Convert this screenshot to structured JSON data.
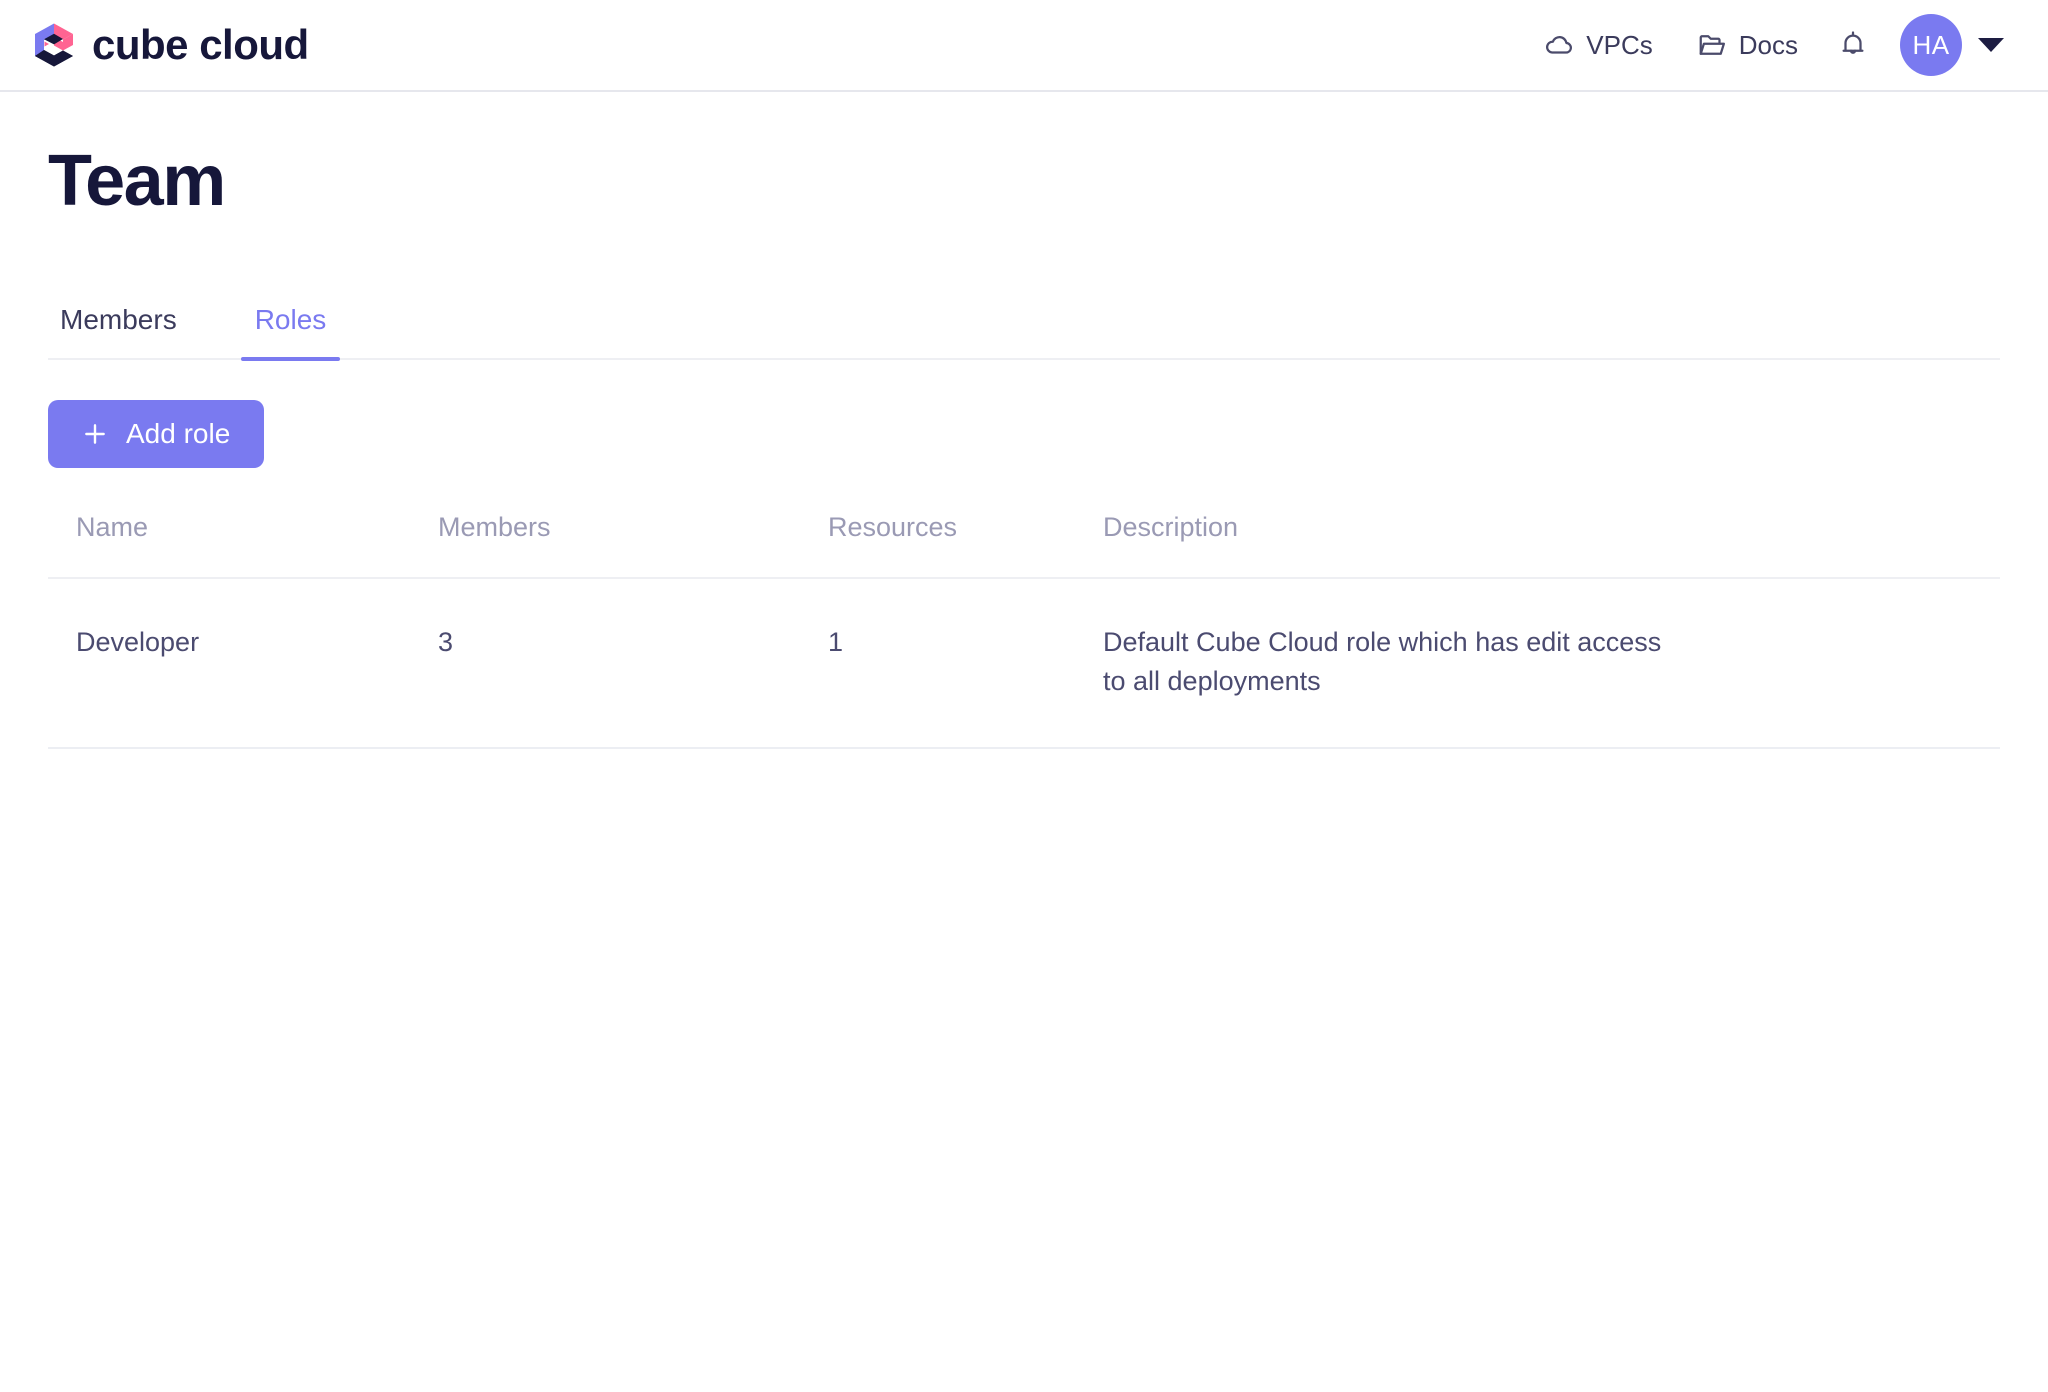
{
  "brand": {
    "name": "cube cloud",
    "logo_icon": "cube-logo-icon",
    "colors": {
      "purple": "#7a7af0",
      "pink": "#ff6492",
      "navy": "#16173a"
    }
  },
  "topnav": {
    "items": [
      {
        "label": "VPCs",
        "icon": "cloud-icon"
      },
      {
        "label": "Docs",
        "icon": "folder-icon"
      }
    ],
    "notifications_icon": "bell-icon",
    "avatar_initials": "HA",
    "avatar_caret_icon": "chevron-down-icon"
  },
  "page": {
    "title": "Team"
  },
  "tabs": [
    {
      "label": "Members",
      "active": false
    },
    {
      "label": "Roles",
      "active": true
    }
  ],
  "toolbar": {
    "add_role_label": "Add role",
    "add_role_icon": "plus-icon"
  },
  "table": {
    "columns": [
      "Name",
      "Members",
      "Resources",
      "Description"
    ],
    "rows": [
      {
        "name": "Developer",
        "members": "3",
        "resources": "1",
        "description": "Default Cube Cloud role which has edit access to all deployments"
      }
    ]
  }
}
